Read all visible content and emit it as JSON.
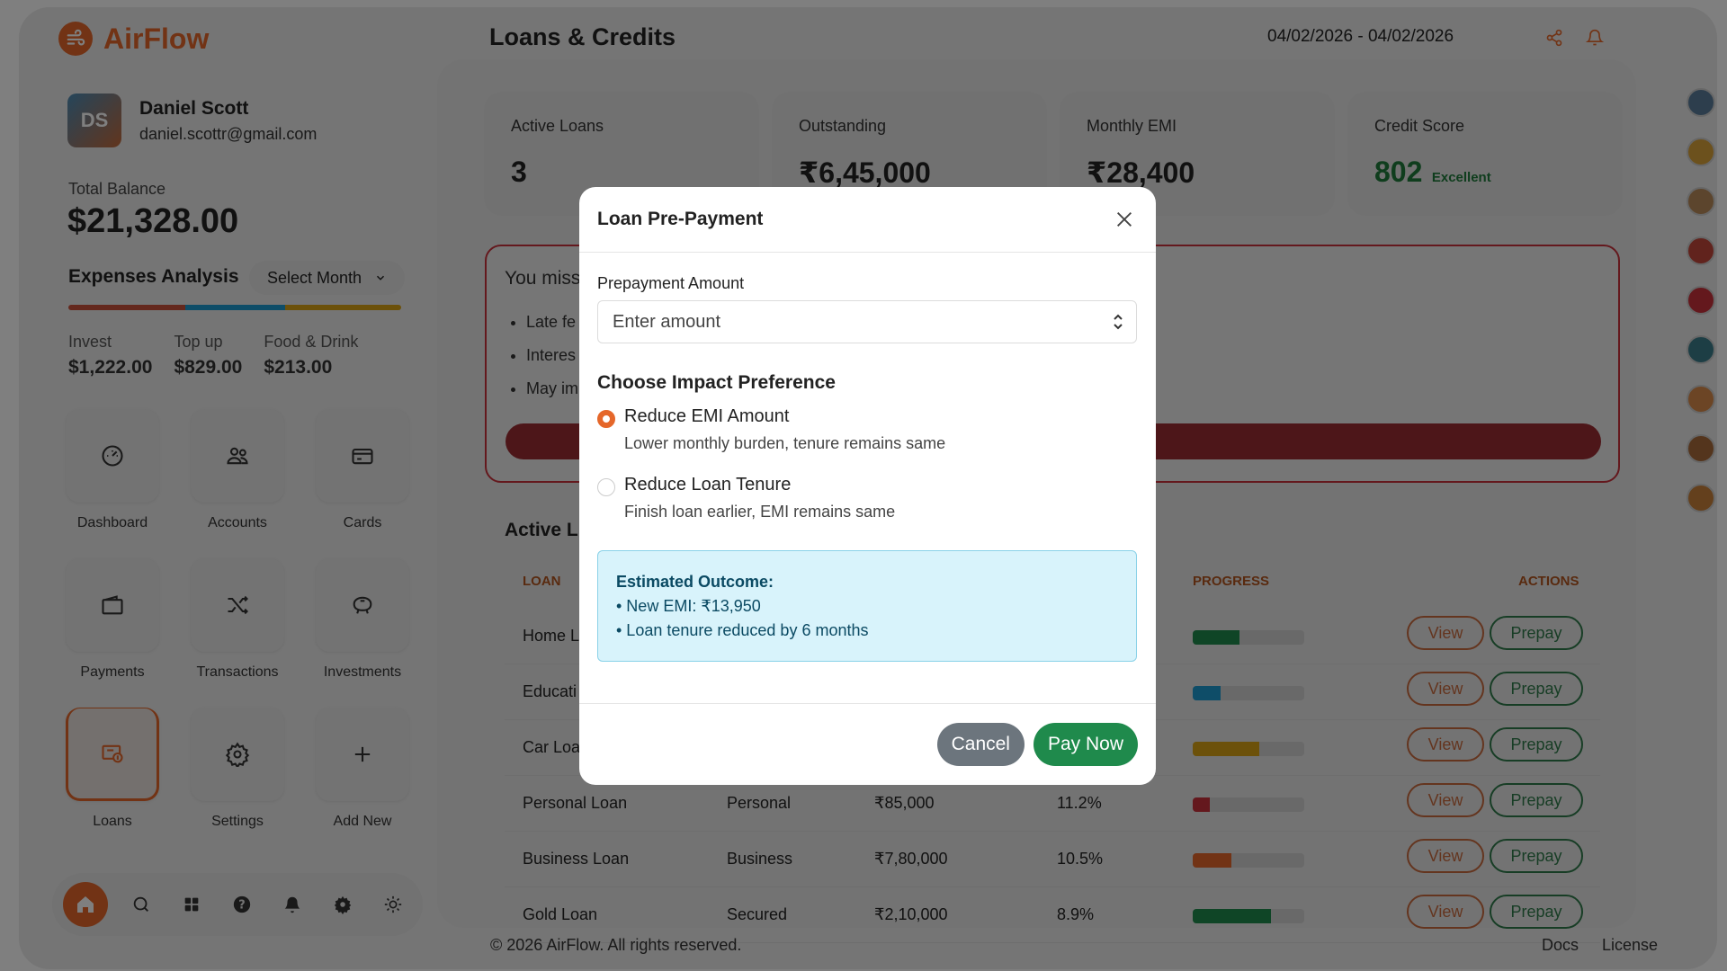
{
  "app": {
    "name": "AirFlow",
    "page_title": "Loans & Credits",
    "date_range": "04/02/2026 - 04/02/2026"
  },
  "profile": {
    "name": "Daniel Scott",
    "email": "daniel.scottr@gmail.com"
  },
  "balance": {
    "label": "Total Balance",
    "value": "$21,328.00"
  },
  "expenses": {
    "title": "Expenses Analysis",
    "select_label": "Select Month",
    "stats": [
      {
        "label": "Invest",
        "value": "$1,222.00"
      },
      {
        "label": "Top up",
        "value": "$829.00"
      },
      {
        "label": "Food & Drink",
        "value": "$213.00"
      }
    ]
  },
  "nav": [
    {
      "label": "Dashboard",
      "icon": "gauge-icon",
      "active": false
    },
    {
      "label": "Accounts",
      "icon": "users-icon",
      "active": false
    },
    {
      "label": "Cards",
      "icon": "card-icon",
      "active": false
    },
    {
      "label": "Payments",
      "icon": "wallet-icon",
      "active": false
    },
    {
      "label": "Transactions",
      "icon": "shuffle-icon",
      "active": false
    },
    {
      "label": "Investments",
      "icon": "piggy-bank-icon",
      "active": false
    },
    {
      "label": "Loans",
      "icon": "loan-icon",
      "active": true
    },
    {
      "label": "Settings",
      "icon": "gear-icon",
      "active": false
    },
    {
      "label": "Add New",
      "icon": "plus-icon",
      "active": false
    }
  ],
  "stats": [
    {
      "label": "Active Loans",
      "value": "3",
      "sub": ""
    },
    {
      "label": "Outstanding",
      "value": "₹6,45,000",
      "sub": ""
    },
    {
      "label": "Monthly EMI",
      "value": "₹28,400",
      "sub": ""
    },
    {
      "label": "Credit Score",
      "value": "802",
      "sub": "Excellent"
    }
  ],
  "alert": {
    "title": "You miss",
    "items": [
      "Late fe",
      "Interes",
      "May im"
    ]
  },
  "loans": {
    "title": "Active L",
    "headers": {
      "loan": "LOAN",
      "progress": "PROGRESS",
      "actions": "ACTIONS"
    },
    "view_label": "View",
    "prepay_label": "Prepay",
    "rows": [
      {
        "name": "Home L",
        "type": "",
        "amount": "",
        "rate": "",
        "progress": 0.42,
        "color": "#1f8a4c"
      },
      {
        "name": "Educati",
        "type": "",
        "amount": "",
        "rate": "",
        "progress": 0.25,
        "color": "#1c9bd0"
      },
      {
        "name": "Car Loa",
        "type": "",
        "amount": "",
        "rate": "",
        "progress": 0.6,
        "color": "#d8a315"
      },
      {
        "name": "Personal Loan",
        "type": "Personal",
        "amount": "₹85,000",
        "rate": "11.2%",
        "progress": 0.15,
        "color": "#c8303a"
      },
      {
        "name": "Business Loan",
        "type": "Business",
        "amount": "₹7,80,000",
        "rate": "10.5%",
        "progress": 0.35,
        "color": "#e5672a"
      },
      {
        "name": "Gold Loan",
        "type": "Secured",
        "amount": "₹2,10,000",
        "rate": "8.9%",
        "progress": 0.7,
        "color": "#1f8a4c"
      }
    ]
  },
  "footer": {
    "copyright": "© 2026 AirFlow. All rights reserved.",
    "docs": "Docs",
    "license": "License"
  },
  "modal": {
    "title": "Loan Pre-Payment",
    "amount_label": "Prepayment Amount",
    "amount_placeholder": "Enter amount",
    "impact_title": "Choose Impact Preference",
    "options": [
      {
        "label": "Reduce EMI Amount",
        "desc": "Lower monthly burden, tenure remains same",
        "checked": true
      },
      {
        "label": "Reduce Loan Tenure",
        "desc": "Finish loan earlier, EMI remains same",
        "checked": false
      }
    ],
    "outcome": {
      "title": "Estimated Outcome:",
      "lines": [
        "• New EMI: ₹13,950",
        "• Loan tenure reduced by 6 months"
      ]
    },
    "cancel_label": "Cancel",
    "pay_label": "Pay Now"
  },
  "colors": {
    "accent": "#e5672a",
    "success": "#1f8a4c",
    "danger": "#c8303a",
    "info_bg": "#d8f3fb"
  }
}
